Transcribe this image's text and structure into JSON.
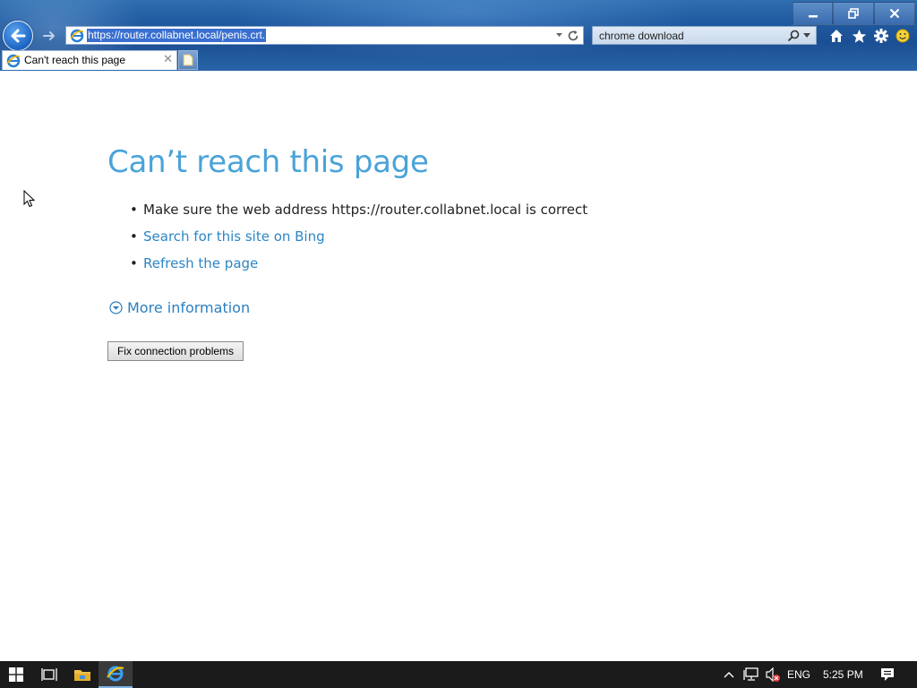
{
  "browser": {
    "address_url": "https://router.collabnet.local/penis.crt.",
    "search_text": "chrome download",
    "tab_title": "Can't reach this page"
  },
  "page": {
    "title": "Can’t reach this page",
    "tip1": "Make sure the web address https://router.collabnet.local is correct",
    "tip2_link": "Search for this site on Bing",
    "tip3_link": "Refresh the page",
    "more_info": "More information",
    "fix_button": "Fix connection problems"
  },
  "taskbar": {
    "language": "ENG",
    "time": "5:25 PM"
  },
  "colors": {
    "title_blue": "#4aa3d8",
    "link_blue": "#2b86c5",
    "chrome_blue": "#1f5aa0",
    "taskbar": "#1b1b1b"
  },
  "icons": [
    "back-arrow-icon",
    "forward-arrow-icon",
    "ie-icon",
    "refresh-icon",
    "search-icon",
    "home-icon",
    "favorites-star-icon",
    "settings-gear-icon",
    "smiley-feedback-icon",
    "minimize-icon",
    "restore-icon",
    "close-icon",
    "new-tab-icon",
    "chevron-down-circle-icon",
    "windows-start-icon",
    "task-view-icon",
    "file-explorer-icon",
    "chevron-up-icon",
    "network-icon",
    "volume-muted-icon",
    "notifications-icon",
    "mouse-cursor-icon"
  ]
}
